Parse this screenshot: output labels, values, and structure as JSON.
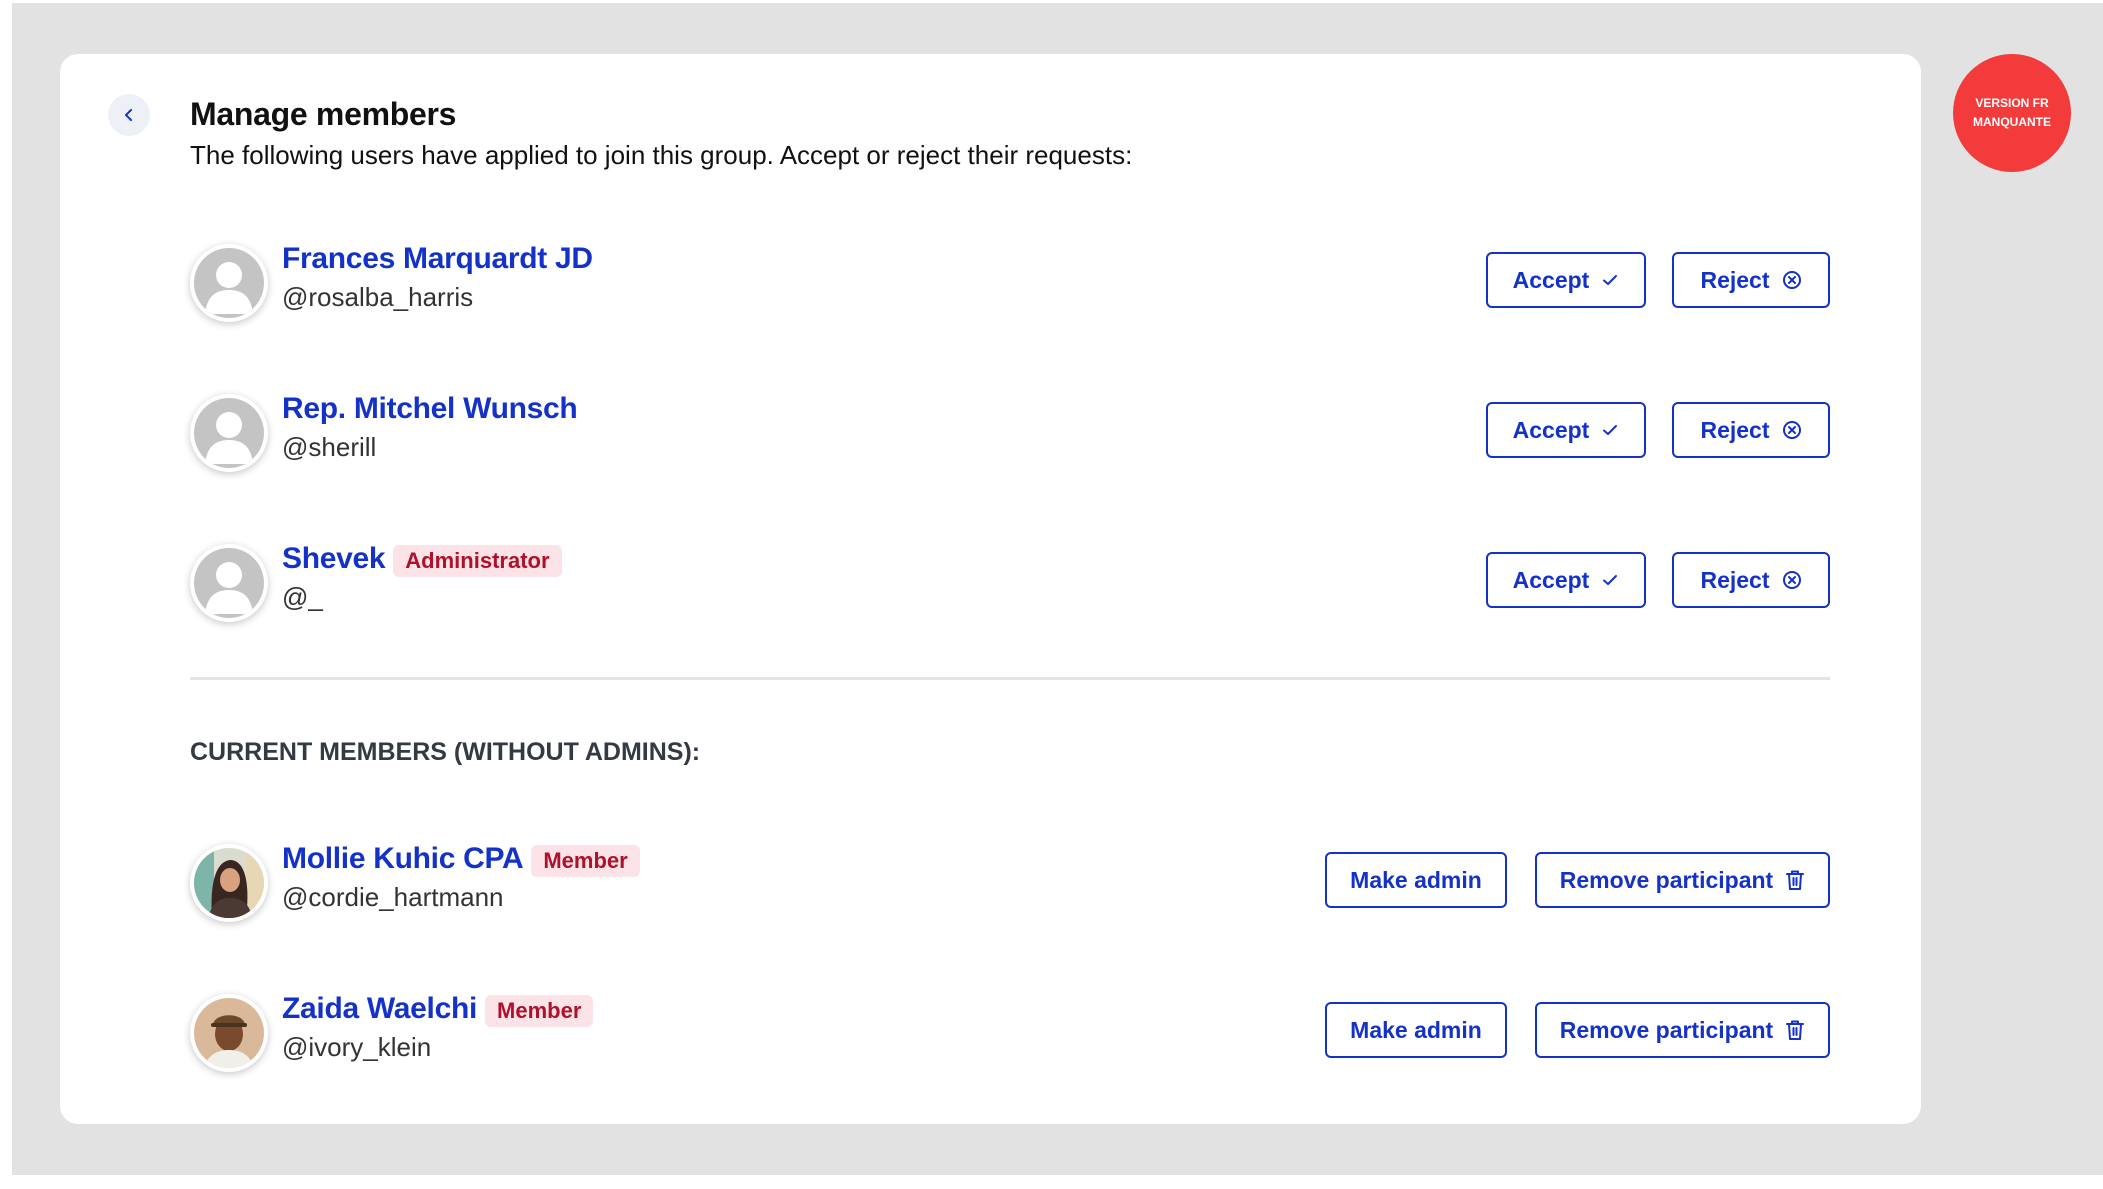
{
  "header": {
    "title": "Manage members",
    "description": "The following users have applied to join this group. Accept or reject their requests:"
  },
  "requests": [
    {
      "name": "Frances Marquardt JD",
      "handle": "@rosalba_harris",
      "badge": ""
    },
    {
      "name": "Rep. Mitchel Wunsch",
      "handle": "@sherill",
      "badge": ""
    },
    {
      "name": "Shevek",
      "handle": "@_",
      "badge": "Administrator"
    }
  ],
  "request_actions": {
    "accept_label": "Accept",
    "reject_label": "Reject"
  },
  "current_members": {
    "title": "CURRENT MEMBERS (WITHOUT ADMINS):",
    "members": [
      {
        "name": "Mollie Kuhic CPA",
        "handle": "@cordie_hartmann",
        "badge": "Member",
        "avatar": "photo-woman"
      },
      {
        "name": "Zaida Waelchi",
        "handle": "@ivory_klein",
        "badge": "Member",
        "avatar": "photo-man-cap"
      }
    ]
  },
  "member_actions": {
    "make_admin_label": "Make admin",
    "remove_label": "Remove participant"
  },
  "language_badge": {
    "text": "VERSION FR\nMANQUANTE",
    "color": "#f43b3b"
  },
  "colors": {
    "accent": "#1432c8",
    "badge_text": "#b0102a",
    "badge_bg": "#fbe3e7",
    "background": "#e2e2e2"
  },
  "icons": {
    "back": "chevron-left-icon",
    "accept": "check-icon",
    "reject": "circle-x-icon",
    "remove": "trash-icon",
    "default_avatar": "default-user-icon"
  }
}
